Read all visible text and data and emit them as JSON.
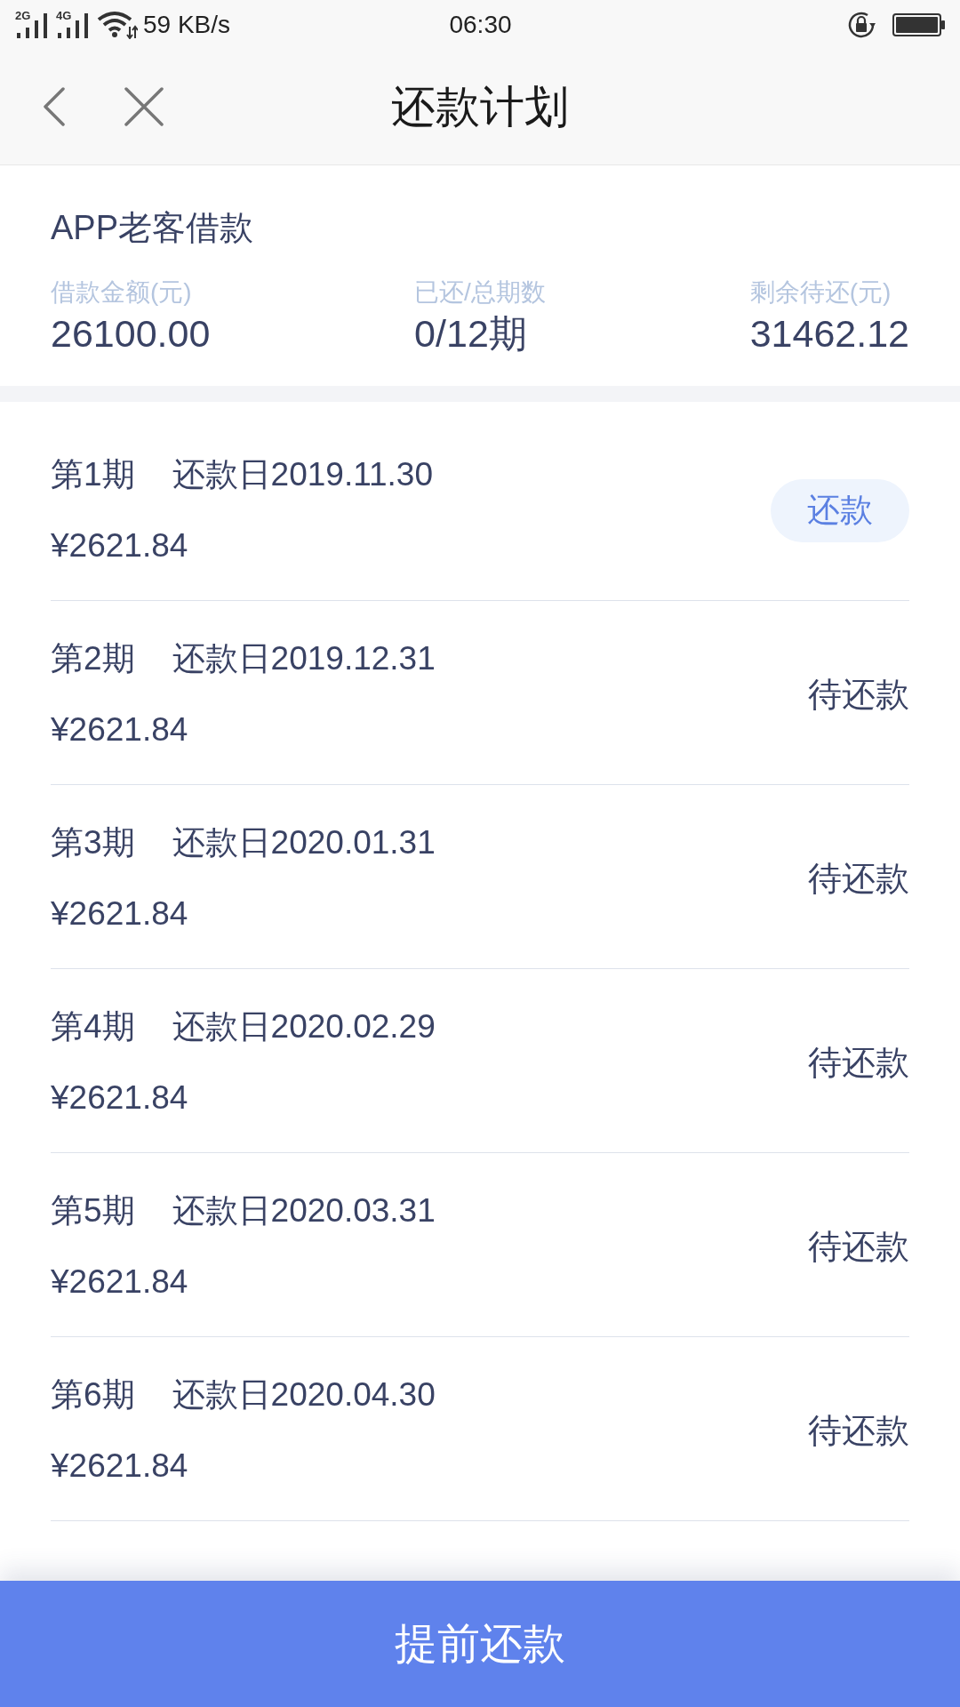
{
  "status_bar": {
    "signal_1_label": "2G",
    "signal_2_label": "4G",
    "speed": "59 KB/s",
    "time": "06:30"
  },
  "header": {
    "title": "还款计划"
  },
  "summary": {
    "title": "APP老客借款",
    "stats": [
      {
        "label": "借款金额(元)",
        "value": "26100.00"
      },
      {
        "label": "已还/总期数",
        "value": "0/12期"
      },
      {
        "label": "剩余待还(元)",
        "value": "31462.12"
      }
    ]
  },
  "installments": [
    {
      "period": "第1期",
      "due": "还款日2019.11.30",
      "amount": "¥2621.84",
      "kind": "button",
      "action": "还款"
    },
    {
      "period": "第2期",
      "due": "还款日2019.12.31",
      "amount": "¥2621.84",
      "kind": "status",
      "action": "待还款"
    },
    {
      "period": "第3期",
      "due": "还款日2020.01.31",
      "amount": "¥2621.84",
      "kind": "status",
      "action": "待还款"
    },
    {
      "period": "第4期",
      "due": "还款日2020.02.29",
      "amount": "¥2621.84",
      "kind": "status",
      "action": "待还款"
    },
    {
      "period": "第5期",
      "due": "还款日2020.03.31",
      "amount": "¥2621.84",
      "kind": "status",
      "action": "待还款"
    },
    {
      "period": "第6期",
      "due": "还款日2020.04.30",
      "amount": "¥2621.84",
      "kind": "status",
      "action": "待还款"
    }
  ],
  "footer": {
    "button": "提前还款"
  }
}
